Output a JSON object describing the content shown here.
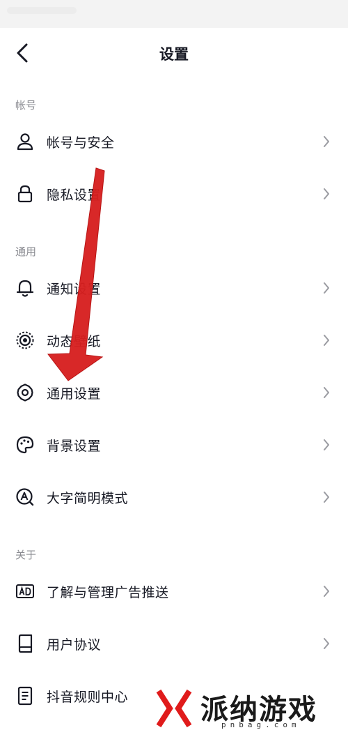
{
  "header": {
    "title": "设置"
  },
  "sections": [
    {
      "header": "帐号",
      "items": [
        {
          "label": "帐号与安全",
          "icon": "user-icon"
        },
        {
          "label": "隐私设置",
          "icon": "lock-icon"
        }
      ]
    },
    {
      "header": "通用",
      "items": [
        {
          "label": "通知设置",
          "icon": "bell-icon"
        },
        {
          "label": "动态壁纸",
          "icon": "live-wallpaper-icon"
        },
        {
          "label": "通用设置",
          "icon": "gear-icon"
        },
        {
          "label": "背景设置",
          "icon": "palette-icon"
        },
        {
          "label": "大字简明模式",
          "icon": "large-font-icon"
        }
      ]
    },
    {
      "header": "关于",
      "items": [
        {
          "label": "了解与管理广告推送",
          "icon": "ad-icon"
        },
        {
          "label": "用户协议",
          "icon": "book-icon"
        },
        {
          "label": "抖音规则中心",
          "icon": "document-icon"
        }
      ]
    }
  ],
  "watermark": {
    "text": "派纳游戏网",
    "sub": "pnbag.com"
  },
  "colors": {
    "arrow": "#d61f1f",
    "text": "#161823",
    "muted": "#8a8b91",
    "chevron": "#9a9ba1"
  }
}
